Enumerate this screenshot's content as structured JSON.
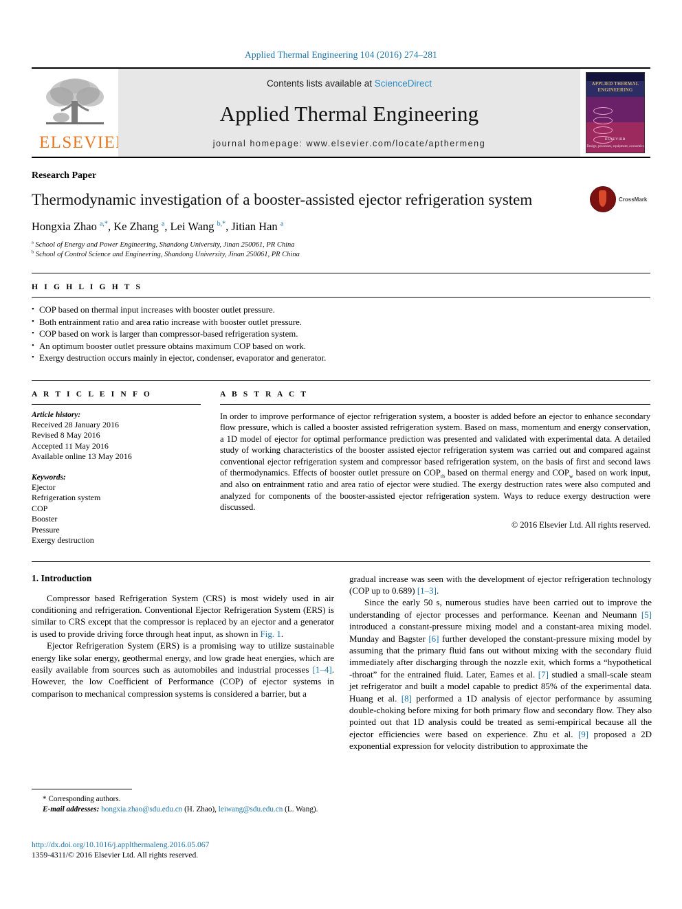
{
  "running_head": "Applied Thermal Engineering 104 (2016) 274–281",
  "masthead": {
    "contents_prefix": "Contents lists available at ",
    "sciencedirect": "ScienceDirect",
    "journal_title": "Applied Thermal Engineering",
    "homepage": "journal homepage: www.elsevier.com/locate/apthermeng",
    "publisher_logo_text": "ELSEVIER",
    "cover": {
      "title": "APPLIED THERMAL ENGINEERING",
      "footer": "Design, processes, equipment, economics",
      "publisher": "ELSEVIER"
    }
  },
  "article": {
    "kind": "Research Paper",
    "title": "Thermodynamic investigation of a booster-assisted ejector refrigeration system",
    "crossmark_label": "CrossMark",
    "authors_html": "Hongxia Zhao <sup>a,*</sup>, Ke Zhang <sup>a</sup>, Lei Wang <sup>b,*</sup>, Jitian Han <sup>a</sup>",
    "affiliations": [
      "School of Energy and Power Engineering, Shandong University, Jinan 250061, PR China",
      "School of Control Science and Engineering, Shandong University, Jinan 250061, PR China"
    ],
    "affiliation_marks": [
      "a",
      "b"
    ]
  },
  "highlights": {
    "label": "H I G H L I G H T S",
    "items": [
      "COP based on thermal input increases with booster outlet pressure.",
      "Both entrainment ratio and area ratio increase with booster outlet pressure.",
      "COP based on work is larger than compressor-based refrigeration system.",
      "An optimum booster outlet pressure obtains maximum COP based on work.",
      "Exergy destruction occurs mainly in ejector, condenser, evaporator and generator."
    ]
  },
  "article_info": {
    "label": "A R T I C L E   I N F O",
    "history_head": "Article history:",
    "history": [
      "Received 28 January 2016",
      "Revised 8 May 2016",
      "Accepted 11 May 2016",
      "Available online 13 May 2016"
    ],
    "keywords_head": "Keywords:",
    "keywords": [
      "Ejector",
      "Refrigeration system",
      "COP",
      "Booster",
      "Pressure",
      "Exergy destruction"
    ]
  },
  "abstract": {
    "label": "A B S T R A C T",
    "paragraph_html": "In order to improve performance of ejector refrigeration system, a booster is added before an ejector to enhance secondary flow pressure, which is called a booster assisted refrigeration system. Based on mass, momentum and energy conservation, a 1D model of ejector for optimal performance prediction was presented and validated with experimental data. A detailed study of working characteristics of the booster assisted ejector refrigeration system was carried out and compared against conventional ejector refrigeration system and compressor based refrigeration system, on the basis of first and second laws of thermodynamics. Effects of booster outlet pressure on COP<sub>th</sub> based on thermal energy and COP<sub>w</sub> based on work input, and also on entrainment ratio and area ratio of ejector were studied. The exergy destruction rates were also computed and analyzed for components of the booster-assisted ejector refrigeration system. Ways to reduce exergy destruction were discussed.",
    "copyright": "© 2016 Elsevier Ltd. All rights reserved."
  },
  "body": {
    "section_heading": "1. Introduction",
    "left_paragraph_1_html": "Compressor based Refrigeration System (CRS) is most widely used in air conditioning and refrigeration. Conventional Ejector Refrigeration System (ERS) is similar to CRS except that the compressor is replaced by an ejector and a generator is used to provide driving force through heat input, as shown in <span class=\"lnk\">Fig. 1</span>.",
    "left_paragraph_2_html": "Ejector Refrigeration System (ERS) is a promising way to utilize sustainable energy like solar energy, geothermal energy, and low grade heat energies, which are easily available from sources such as automobiles and industrial processes <span class=\"lnk\">[1–4]</span>. However, the low Coefficient of Performance (COP) of ejector systems in comparison to mechanical compression systems is considered a barrier, but a",
    "right_paragraph_1_html": "gradual increase was seen with the development of ejector refrigeration technology (COP up to 0.689) <span class=\"lnk\">[1–3]</span>.",
    "right_paragraph_2_html": "Since the early 50 s, numerous studies have been carried out to improve the understanding of ejector processes and performance. Keenan and Neumann <span class=\"lnk\">[5]</span> introduced a constant-pressure mixing model and a constant-area mixing model. Munday and Bagster <span class=\"lnk\">[6]</span> further developed the constant-pressure mixing model by assuming that the primary fluid fans out without mixing with the secondary fluid immediately after discharging through the nozzle exit, which forms a “hypothetical -throat” for the entrained fluid. Later, Eames et al. <span class=\"lnk\">[7]</span> studied a small-scale steam jet refrigerator and built a model capable to predict 85% of the experimental data. Huang et al. <span class=\"lnk\">[8]</span> performed a 1D analysis of ejector performance by assuming double-choking before mixing for both primary flow and secondary flow. They also pointed out that 1D analysis could be treated as semi-empirical because all the ejector efficiencies were based on experience. Zhu et al. <span class=\"lnk\">[9]</span> proposed a 2D exponential expression for velocity distribution to approximate the"
  },
  "footnotes": {
    "corresponding": "* Corresponding authors.",
    "emails_html": "<i>E-mail addresses:</i> <span class=\"lnk\">hongxia.zhao@sdu.edu.cn</span> (H. Zhao), <span class=\"lnk\">leiwang@sdu.edu.cn</span> (L. Wang).",
    "doi": "http://dx.doi.org/10.1016/j.applthermaleng.2016.05.067",
    "issn": "1359-4311/© 2016 Elsevier Ltd. All rights reserved."
  },
  "colors": {
    "link": "#1b72a8",
    "elsevier_orange": "#e87722",
    "masthead_bg": "#e7e7e7"
  }
}
